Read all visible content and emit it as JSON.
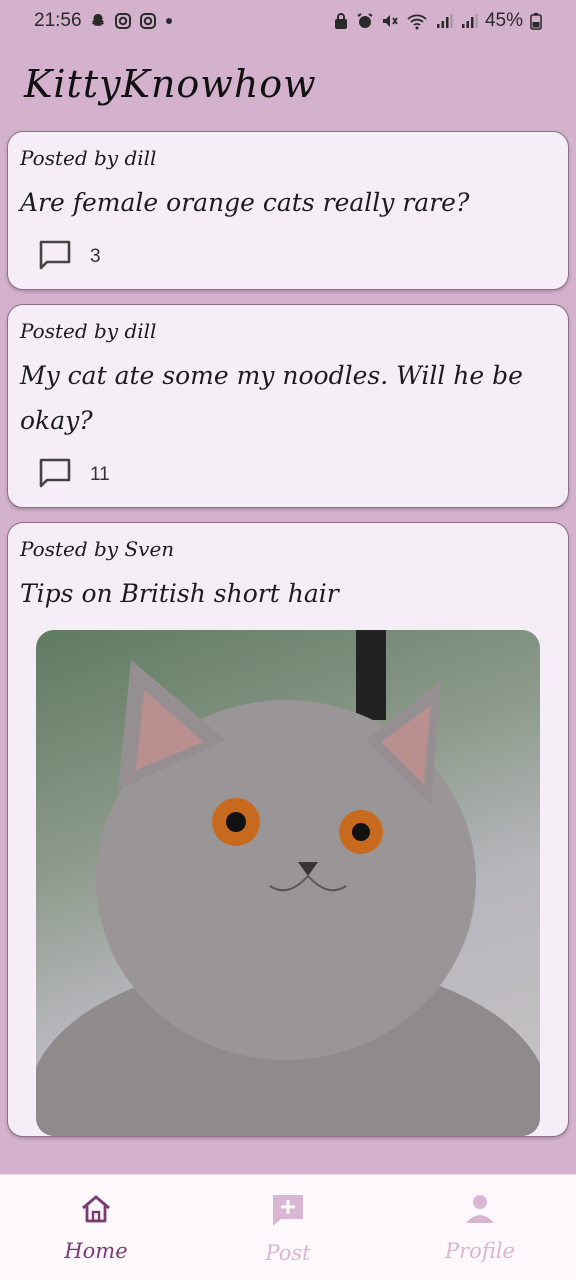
{
  "status_bar": {
    "time": "21:56",
    "battery": "45%",
    "icons": [
      "snapchat-icon",
      "instagram-icon",
      "instagram-icon",
      "dot-icon",
      "lock-icon",
      "alarm-icon",
      "mute-icon",
      "wifi-icon",
      "signal-icon",
      "signal-icon",
      "battery-icon"
    ]
  },
  "app": {
    "title": "KittyKnowhow"
  },
  "posts": [
    {
      "author": "Posted by dill",
      "title": "Are female orange cats really rare?",
      "comments": "3"
    },
    {
      "author": "Posted by dill",
      "title": "My cat ate some my noodles. Will he be okay?",
      "comments": "11"
    },
    {
      "author": "Posted by Sven",
      "title": "Tips on British short hair",
      "image": "cat-photo"
    }
  ],
  "nav": {
    "items": [
      {
        "label": "Home",
        "icon": "home-icon",
        "active": true
      },
      {
        "label": "Post",
        "icon": "add-post-icon",
        "active": false
      },
      {
        "label": "Profile",
        "icon": "profile-icon",
        "active": false
      }
    ]
  },
  "colors": {
    "background": "#d4b2cd",
    "card": "#f6eef6",
    "accent": "#7b3a72",
    "inactive": "#d9b7d3"
  }
}
